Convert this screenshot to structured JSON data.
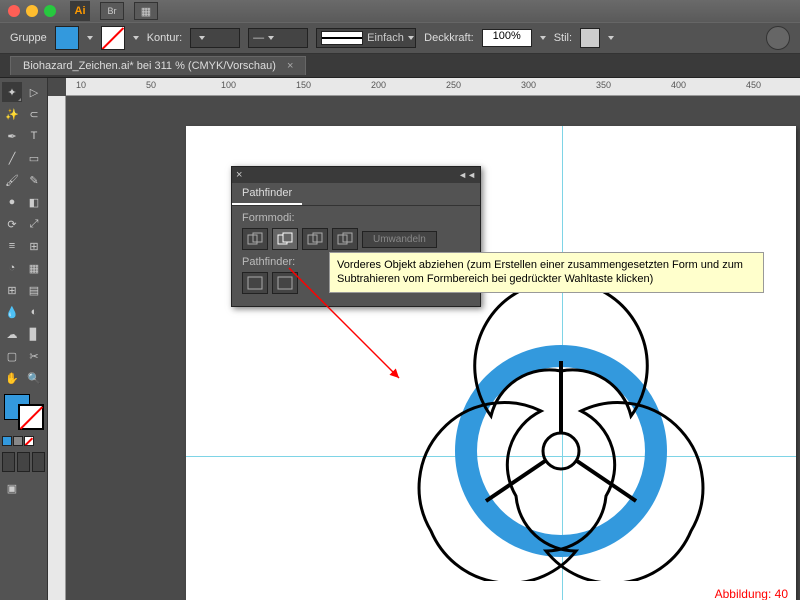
{
  "titlebar": {
    "app": "Ai",
    "btn1": "Br",
    "panel_icon": "▦"
  },
  "controlbar": {
    "group_label": "Gruppe",
    "stroke_label": "Kontur:",
    "stroke_style": "Einfach",
    "opacity_label": "Deckkraft:",
    "opacity_value": "100%",
    "style_label": "Stil:"
  },
  "colors": {
    "fill": "#3399dd",
    "accent": "#3399dd"
  },
  "doc": {
    "tab_title": "Biohazard_Zeichen.ai* bei 311 % (CMYK/Vorschau)",
    "close": "×"
  },
  "ruler": {
    "marks": [
      "10",
      "50",
      "100",
      "150",
      "200",
      "250",
      "300",
      "350",
      "400",
      "450"
    ]
  },
  "pathfinder": {
    "title": "Pathfinder",
    "section1": "Formmodi:",
    "expand": "Umwandeln",
    "section2": "Pathfinder:",
    "close": "×",
    "collapse": "◄◄"
  },
  "tooltip": {
    "text": "Vorderes Objekt abziehen (zum Erstellen einer zusammengesetzten Form und zum Subtrahieren vom Formbereich bei gedrückter Wahltaste klicken)"
  },
  "caption": {
    "text": "Abbildung: 40"
  }
}
